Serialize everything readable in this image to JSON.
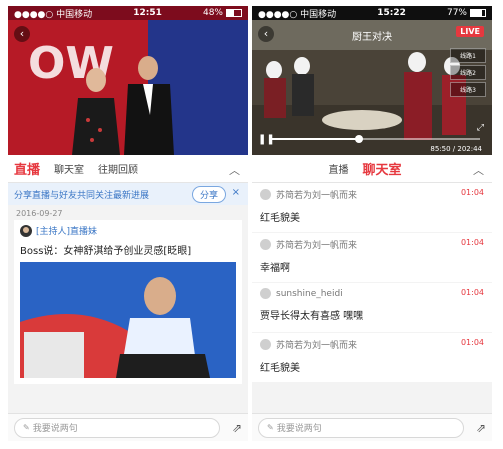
{
  "left": {
    "status": {
      "carrier": "●●●●○ 中国移动",
      "wifi": "WiFi",
      "time": "12:51",
      "battery": "48%",
      "battery_level": 0.48
    },
    "tabs": [
      {
        "label": "直播",
        "active": true
      },
      {
        "label": "聊天室",
        "active": false
      },
      {
        "label": "往期回顾",
        "active": false
      }
    ],
    "share": {
      "text": "分享直播与好友共同关注最新进展",
      "button": "分享",
      "close": "×"
    },
    "post": {
      "date": "2016-09-27",
      "host": "[主持人]直播妹",
      "text": "Boss说：女神舒淇给予创业灵感[眨眼]"
    },
    "composer": {
      "placeholder": "我要说两句"
    }
  },
  "right": {
    "status": {
      "carrier": "●●●●○ 中国移动",
      "wifi": "WiFi",
      "time": "15:22",
      "battery": "77%",
      "battery_level": 0.77
    },
    "video": {
      "title": "厨王对决",
      "badge": "LIVE",
      "time": "85:50 / 202:44",
      "progress": 0.42,
      "side": [
        "线路1",
        "线路2",
        "线路3"
      ]
    },
    "tabs": [
      {
        "label": "直播",
        "active": false
      },
      {
        "label": "聊天室",
        "active": true
      }
    ],
    "messages": [
      {
        "user": "苏简若为刘一帆而来",
        "time": "01:04",
        "text": "红毛貌美"
      },
      {
        "user": "苏简若为刘一帆而来",
        "time": "01:04",
        "text": "幸福啊"
      },
      {
        "user": "sunshine_heidi",
        "time": "01:04",
        "text": "贾导长得太有喜感 嘿嘿"
      },
      {
        "user": "苏简若为刘一帆而来",
        "time": "01:04",
        "text": "红毛貌美"
      }
    ],
    "composer": {
      "placeholder": "我要说两句"
    }
  }
}
